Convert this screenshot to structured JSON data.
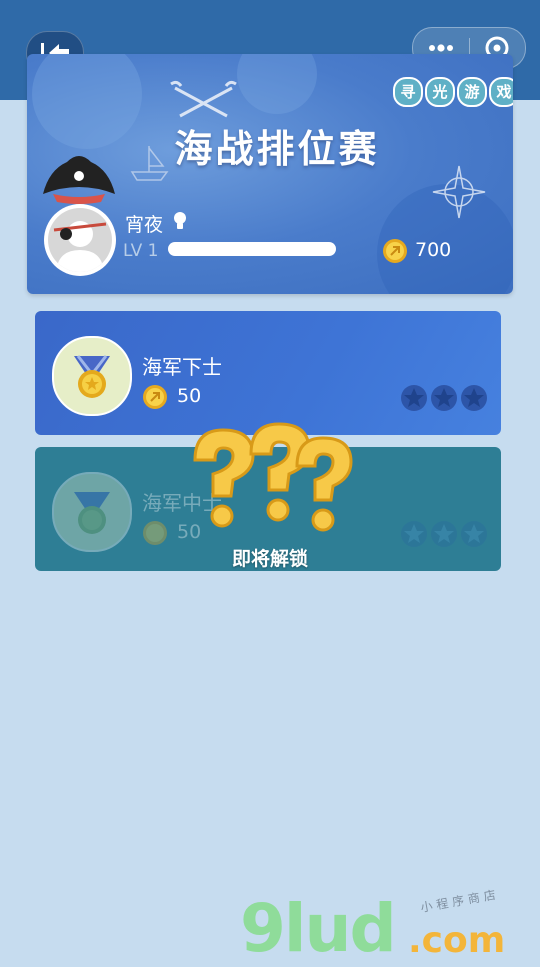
{
  "header": {
    "back_icon": "back-arrow-icon",
    "more_icon": "more-dots-icon",
    "close_icon": "circle-target-icon"
  },
  "banner": {
    "title": "海战排位赛",
    "logo_chars": [
      "寻",
      "光",
      "游",
      "戏"
    ],
    "player": {
      "name": "宵夜",
      "level": "LV 1",
      "level_progress": 0,
      "coins": "700"
    }
  },
  "ranks": [
    {
      "name": "海军下士",
      "cost": "50",
      "stars_earned": 0,
      "stars_total": 3,
      "locked": false
    },
    {
      "name": "海军中士",
      "cost": "50",
      "stars_earned": 0,
      "stars_total": 3,
      "locked": true
    }
  ],
  "lock": {
    "label": "即将解锁"
  },
  "watermark": {
    "brand": "9lud",
    "domain": ".com",
    "tagline": "小程序商店"
  },
  "colors": {
    "topbar": "#2f6aa8",
    "background": "#c6dcef",
    "card_active": "#3e74d6",
    "card_locked": "#2e7e95",
    "coin": "#f2c234"
  }
}
